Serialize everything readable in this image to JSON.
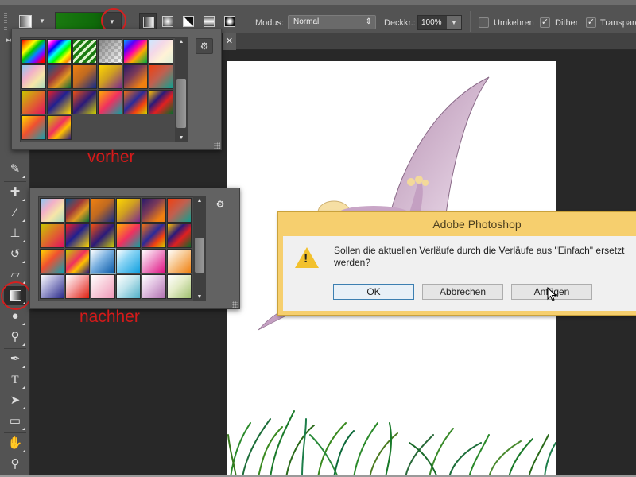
{
  "options_bar": {
    "mode_label": "Modus:",
    "mode_value": "Normal",
    "opacity_label": "Deckkr.:",
    "opacity_value": "100%",
    "reverse_label": "Umkehren",
    "reverse_checked": false,
    "dither_label": "Dither",
    "dither_checked": true,
    "transparency_label": "Transparenz",
    "transparency_checked": true,
    "check_glyph": "✓",
    "arrow_glyph": "▼",
    "updown_glyph": "⇕",
    "gradient_type_active": "linear"
  },
  "doc_tab": {
    "close_glyph": "✕"
  },
  "toolbar": {
    "head_glyph": "▸▸",
    "tools": [
      {
        "name": "eyedropper",
        "glyph": "✎"
      },
      {
        "name": "healing-brush",
        "glyph": "✚"
      },
      {
        "name": "brush",
        "glyph": "∕"
      },
      {
        "name": "stamp",
        "glyph": "⊥"
      },
      {
        "name": "history-brush",
        "glyph": "↺"
      },
      {
        "name": "eraser",
        "glyph": "▱"
      },
      {
        "name": "gradient",
        "glyph": "▣",
        "active": true
      },
      {
        "name": "blur",
        "glyph": "●"
      },
      {
        "name": "dodge",
        "glyph": "⚲"
      },
      {
        "name": "pen",
        "glyph": "✒"
      },
      {
        "name": "type",
        "glyph": "T"
      },
      {
        "name": "path-selection",
        "glyph": "➤"
      },
      {
        "name": "rectangle",
        "glyph": "▭"
      },
      {
        "name": "hand",
        "glyph": "✋"
      },
      {
        "name": "zoom",
        "glyph": "⚲"
      }
    ]
  },
  "panel_before": {
    "annotation": "vorher",
    "gear_glyph": "⚙",
    "swatches": [
      "linear-gradient(135deg,#f00 0%,#f80 15%,#ff0 30%,#0c0 45%,#08f 60%,#80f 75%,#f00 90%)",
      "linear-gradient(135deg,#fff 0%,#f0f 15%,#00f 30%,#0ff 45%,#0f0 60%,#ff0 75%,#f80 90%,#fff 100%)",
      "repeating-linear-gradient(135deg,#1a7a10 0 4px,#ddf4cc 4px 7px)",
      "linear-gradient(135deg,rgba(120,120,120,.9),rgba(255,255,255,.2)),repeating-conic-gradient(#bbb 0 25%,#fff 0 50%) 0 0/8px 8px",
      "linear-gradient(135deg,#0af 0%,#50f 25%,#f0a 45%,#fa0 65%,#0a4 100%)",
      "linear-gradient(135deg,#cde8ff 0%,#f4d8e8 35%,#fff2d6 65%,#dff0da 100%)",
      "linear-gradient(135deg,#8dc8f2 0%,#f2b0c8 35%,#f6e6a8 65%,#a8d8c0 100%)",
      "linear-gradient(135deg,#0a5a8a 0%,#a03a3a 40%,#e09a20 65%,#0a6a3a 100%)",
      "linear-gradient(135deg,#f08010 0%,#c06a20 45%,#102a8a 100%)",
      "linear-gradient(135deg,#ffd800 0%,#d0a020 45%,#7a2a90 100%)",
      "linear-gradient(135deg,#2a1a6a 0%,#7a3a5a 40%,#f08010 80%)",
      "linear-gradient(135deg,#f04010 0%,#c06050 45%,#10a090 100%)",
      "linear-gradient(135deg,#c8c800 0%,#e06030 55%,#e01060 100%)",
      "linear-gradient(135deg,#f02020 0%,#202090 45%,#ffd800 100%)",
      "linear-gradient(135deg,#f05010 0%,#2a1a7a 50%,#d0d000 100%)",
      "linear-gradient(135deg,#ffb000 0%,#f03060 50%,#10a0a0 100%)",
      "linear-gradient(135deg,#f07010 0%,#2a2a9a 45%,#f04010 70%,#d0d000 100%)",
      "linear-gradient(135deg,#ffc000 0%,#2a1a7a 35%,#e02020 60%,#0a6a2a 100%)",
      "linear-gradient(135deg,#ffd800 0%,#f05030 45%,#10a0b0 100%)",
      "linear-gradient(135deg,#c0d000 0%,#f03060 45%,#ffc000 65%,#2a1a7a 100%)"
    ]
  },
  "panel_after": {
    "annotation": "nachher",
    "gear_glyph": "⚙",
    "swatches": [
      "linear-gradient(135deg,#8dc8f2 0%,#f2b0c8 35%,#f6e6a8 65%,#a8d8c0 100%)",
      "linear-gradient(135deg,#0a5a8a 0%,#a03a3a 40%,#e09a20 65%,#0a6a3a 100%)",
      "linear-gradient(135deg,#f08010 0%,#c06a20 45%,#102a8a 100%)",
      "linear-gradient(135deg,#ffd800 0%,#d0a020 45%,#7a2a90 100%)",
      "linear-gradient(135deg,#2a1a6a 0%,#7a3a5a 40%,#f08010 80%)",
      "linear-gradient(135deg,#f04010 0%,#c06050 45%,#10a090 100%)",
      "linear-gradient(135deg,#c8c800 0%,#e06030 55%,#e01060 100%)",
      "linear-gradient(135deg,#f02020 0%,#202090 45%,#ffd800 100%)",
      "linear-gradient(135deg,#f05010 0%,#2a1a7a 50%,#d0d000 100%)",
      "linear-gradient(135deg,#ffb000 0%,#f03060 50%,#10a0a0 100%)",
      "linear-gradient(135deg,#f07010 0%,#2a2a9a 45%,#f04010 70%,#d0d000 100%)",
      "linear-gradient(135deg,#ffc000 0%,#2a1a7a 35%,#e02020 60%,#0a6a2a 100%)",
      "linear-gradient(135deg,#ffd800 0%,#f05030 45%,#10a0b0 100%)",
      "linear-gradient(135deg,#c0d000 0%,#f03060 45%,#ffc000 65%,#2a1a7a 100%)",
      "linear-gradient(135deg,#ffffff 0%,#7ab0e0 45%,#0a5aa8 100%)",
      "linear-gradient(135deg,#ffffff 0%,#8ad4f4 40%,#10a0e0 100%)",
      "linear-gradient(135deg,#ffffff 0%,#f0a0d0 40%,#e01080 100%)",
      "linear-gradient(135deg,#ffffff 0%,#f8d0a0 40%,#f08010 100%)",
      "linear-gradient(135deg,#ffffff 0%,#a0a0d0 45%,#2a2a8a 100%)",
      "linear-gradient(135deg,#ffffff 0%,#f4a0a0 45%,#e02010 100%)",
      "linear-gradient(135deg,#ffffff 0%,#f8d0dc 45%,#f098b8 100%)",
      "linear-gradient(135deg,#ffffff 0%,#c0e4ec 45%,#50b0c8 100%)",
      "linear-gradient(135deg,#ffffff 0%,#e0c0e0 45%,#b070b0 100%)",
      "linear-gradient(135deg,#ffffff 0%,#e4ecc8 45%,#a0c070 100%)"
    ],
    "selected_index": 14
  },
  "dialog": {
    "title": "Adobe Photoshop",
    "message": "Sollen die aktuellen Verläufe durch die Verläufe aus \"Einfach\" ersetzt werden?",
    "warning_glyph": "!",
    "buttons": {
      "ok": "OK",
      "cancel": "Abbrechen",
      "append": "Anfügen"
    }
  },
  "colors": {
    "annotation_red": "#d41a1a",
    "foreground_gradient_start": "#1a7a10",
    "foreground_gradient_end": "#0d3f0a",
    "dialog_frame": "#f6cf6e"
  }
}
